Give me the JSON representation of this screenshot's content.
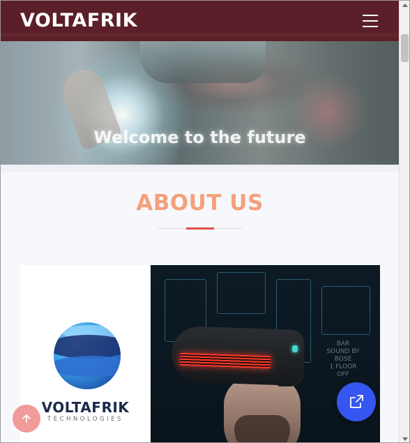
{
  "header": {
    "brand": "VOLTAFRIK",
    "menu_icon": "hamburger-menu-icon"
  },
  "hero": {
    "text": "Welcome to the future"
  },
  "about": {
    "title": "ABOUT US",
    "logo": {
      "name": "VOLTAFRIK",
      "subtitle": "TECHNOLOGIES"
    },
    "photo_sign": [
      "BAR",
      "SOUND BY",
      "BOSE",
      "1 FLOOR",
      "OFF"
    ]
  },
  "buttons": {
    "scroll_top_icon": "arrow-up-icon",
    "share_icon": "share-icon"
  },
  "colors": {
    "header_bg": "#5a1f28",
    "about_title": "#f4a07a",
    "accent_divider": "#e0504b",
    "share_fab": "#3556f0",
    "scroll_top": "#f19b9b"
  }
}
